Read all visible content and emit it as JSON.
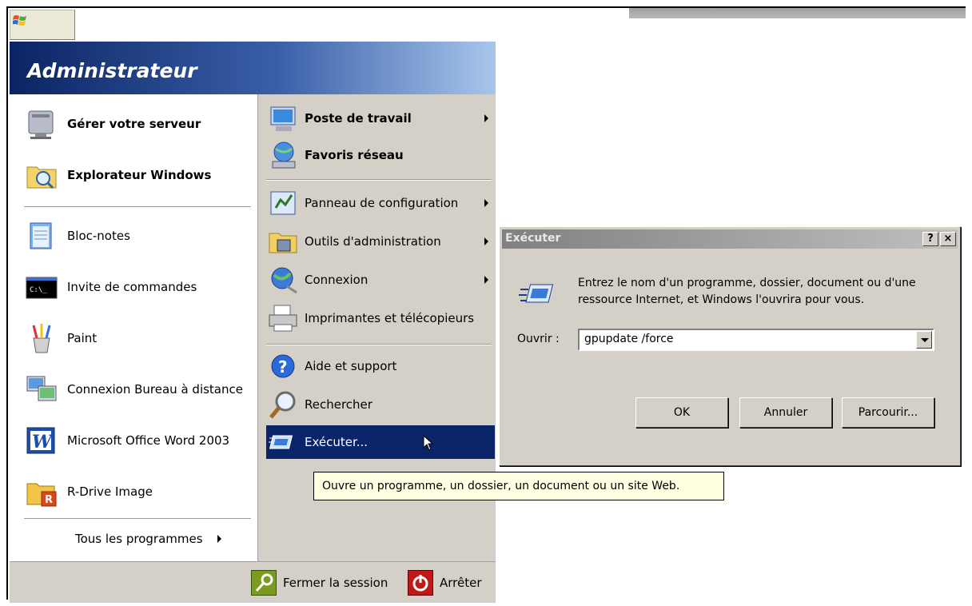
{
  "start_menu": {
    "user_name": "Administrateur",
    "pinned": [
      {
        "label": "Gérer votre serveur",
        "icon": "server-icon"
      },
      {
        "label": "Explorateur Windows",
        "icon": "folder-explorer-icon"
      }
    ],
    "recent": [
      {
        "label": "Bloc-notes",
        "icon": "notepad-icon"
      },
      {
        "label": "Invite de commandes",
        "icon": "command-prompt-icon"
      },
      {
        "label": "Paint",
        "icon": "paint-icon"
      },
      {
        "label": "Connexion Bureau à distance",
        "icon": "remote-desktop-icon"
      },
      {
        "label": "Microsoft Office Word 2003",
        "icon": "word-icon"
      },
      {
        "label": "R-Drive Image",
        "icon": "rdrive-icon"
      }
    ],
    "all_programs": "Tous les programmes",
    "right_items": [
      {
        "label": "Poste de travail",
        "icon": "computer-icon",
        "bold": true,
        "submenu": true
      },
      {
        "label": "Favoris réseau",
        "icon": "network-icon",
        "bold": true,
        "submenu": false
      },
      {
        "label": "Panneau de configuration",
        "icon": "control-panel-icon",
        "bold": false,
        "submenu": true
      },
      {
        "label": "Outils d'administration",
        "icon": "admin-tools-icon",
        "bold": false,
        "submenu": true
      },
      {
        "label": "Connexion",
        "icon": "connect-globe-icon",
        "bold": false,
        "submenu": true
      },
      {
        "label": "Imprimantes et télécopieurs",
        "icon": "printer-icon",
        "bold": false,
        "submenu": false
      },
      {
        "label": "Aide et support",
        "icon": "help-icon",
        "bold": false,
        "submenu": false
      },
      {
        "label": "Rechercher",
        "icon": "search-icon",
        "bold": false,
        "submenu": false
      },
      {
        "label": "Exécuter...",
        "icon": "run-icon",
        "bold": false,
        "submenu": false,
        "highlighted": true
      }
    ],
    "logoff": "Fermer la session",
    "shutdown": "Arrêter"
  },
  "tooltip": "Ouvre un programme, un dossier, un document ou un site Web.",
  "run_dialog": {
    "title": "Exécuter",
    "help_btn": "?",
    "close_btn": "×",
    "description": "Entrez le nom d'un programme, dossier, document ou d'une ressource Internet, et Windows l'ouvrira pour vous.",
    "open_label": "Ouvrir :",
    "open_value": "gpupdate /force",
    "ok": "OK",
    "cancel": "Annuler",
    "browse": "Parcourir..."
  },
  "colors": {
    "highlight": "#0a246a",
    "menu_bg": "#d4d0c8",
    "tooltip_bg": "#ffffe1"
  }
}
